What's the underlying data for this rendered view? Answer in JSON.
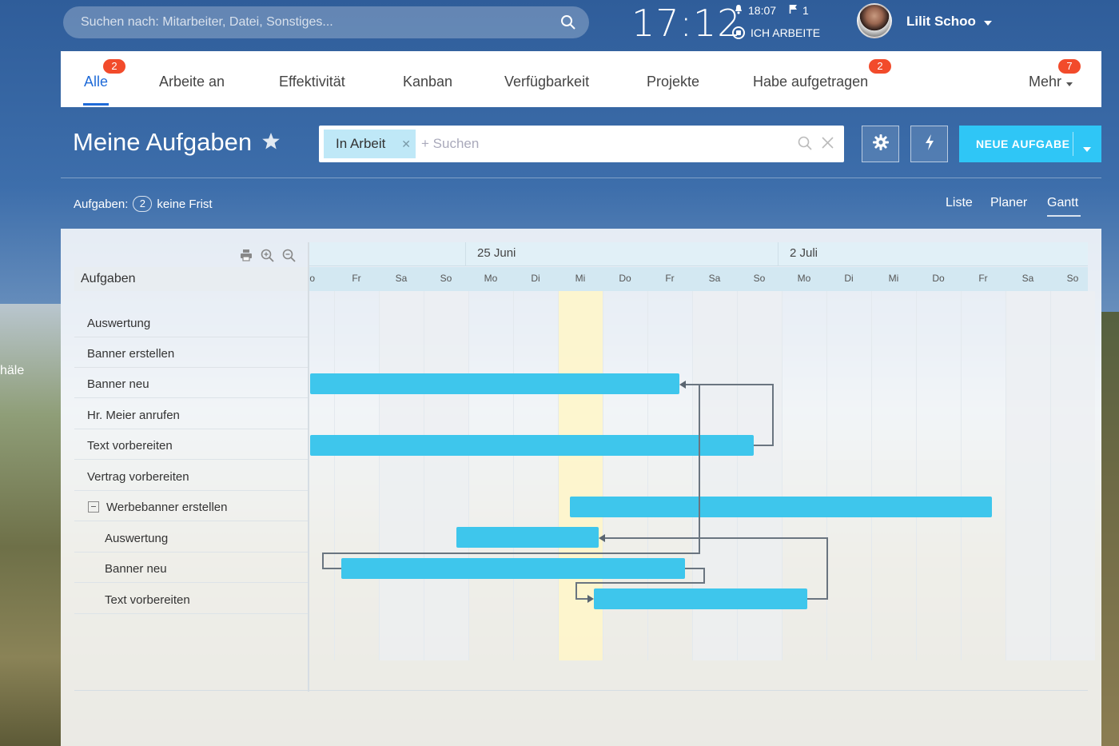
{
  "search": {
    "placeholder": "Suchen nach: Mitarbeiter, Datei, Sonstiges..."
  },
  "header": {
    "clock": "17:12",
    "time_small": "18:07",
    "flag_count": "1",
    "work_status": "ICH ARBEITE",
    "user_name": "Lilit Schoo"
  },
  "background_text": "häle",
  "tabs": [
    {
      "label": "Alle",
      "badge": "2"
    },
    {
      "label": "Arbeite an",
      "badge": ""
    },
    {
      "label": "Effektivität",
      "badge": ""
    },
    {
      "label": "Kanban",
      "badge": ""
    },
    {
      "label": "Verfügbarkeit",
      "badge": ""
    },
    {
      "label": "Projekte",
      "badge": ""
    },
    {
      "label": "Habe aufgetragen",
      "badge": "2"
    },
    {
      "label": "Mehr",
      "badge": "7"
    }
  ],
  "page": {
    "title": "Meine Aufgaben",
    "filter_chip": "In Arbeit",
    "filter_placeholder": "+ Suchen",
    "new_task_label": "NEUE AUFGABE",
    "count_prefix": "Aufgaben:",
    "count": "2",
    "count_suffix": "keine Frist",
    "views": [
      "Liste",
      "Planer",
      "Gantt"
    ],
    "active_view": "Gantt"
  },
  "tree": {
    "header": "Aufgaben",
    "rows": [
      {
        "label": "Auswertung",
        "level": 0
      },
      {
        "label": "Banner erstellen",
        "level": 0
      },
      {
        "label": "Banner neu",
        "level": 0
      },
      {
        "label": "Hr. Meier anrufen",
        "level": 0
      },
      {
        "label": "Text vorbereiten",
        "level": 0
      },
      {
        "label": "Vertrag vorbereiten",
        "level": 0
      },
      {
        "label": "Werbebanner erstellen",
        "level": 0,
        "collapsible": true
      },
      {
        "label": "Auswertung",
        "level": 1
      },
      {
        "label": "Banner neu",
        "level": 1
      },
      {
        "label": "Text vorbereiten",
        "level": 1
      }
    ]
  },
  "gantt": {
    "weeks": [
      "25 Juni",
      "2 Juli"
    ],
    "days": [
      "o",
      "Fr",
      "Sa",
      "So",
      "Mo",
      "Di",
      "Mi",
      "Do",
      "Fr",
      "Sa",
      "So",
      "Mo",
      "Di",
      "Mi",
      "Do",
      "Fr",
      "Sa",
      "So"
    ],
    "today": "Mi",
    "bars": [
      {
        "task": "Banner neu",
        "row": 2,
        "start": "Do",
        "end": "Fr"
      },
      {
        "task": "Text vorbereiten",
        "row": 4,
        "start": "Do",
        "end": "Sa"
      },
      {
        "task": "Werbebanner erstellen",
        "row": 6,
        "start": "Mi",
        "end": "Mi"
      },
      {
        "task": "Auswertung",
        "row": 7,
        "start": "Mo",
        "end": "Mi"
      },
      {
        "task": "Banner neu",
        "row": 8,
        "start": "Fr",
        "end": "Fr"
      },
      {
        "task": "Text vorbereiten",
        "row": 9,
        "start": "Mi",
        "end": "Mo"
      }
    ]
  },
  "colors": {
    "accent": "#2fc6f6",
    "bar": "#3ec6ec",
    "badge": "#f24b2b",
    "active_tab": "#1f6bd8",
    "today_column": "#fff6c8"
  }
}
